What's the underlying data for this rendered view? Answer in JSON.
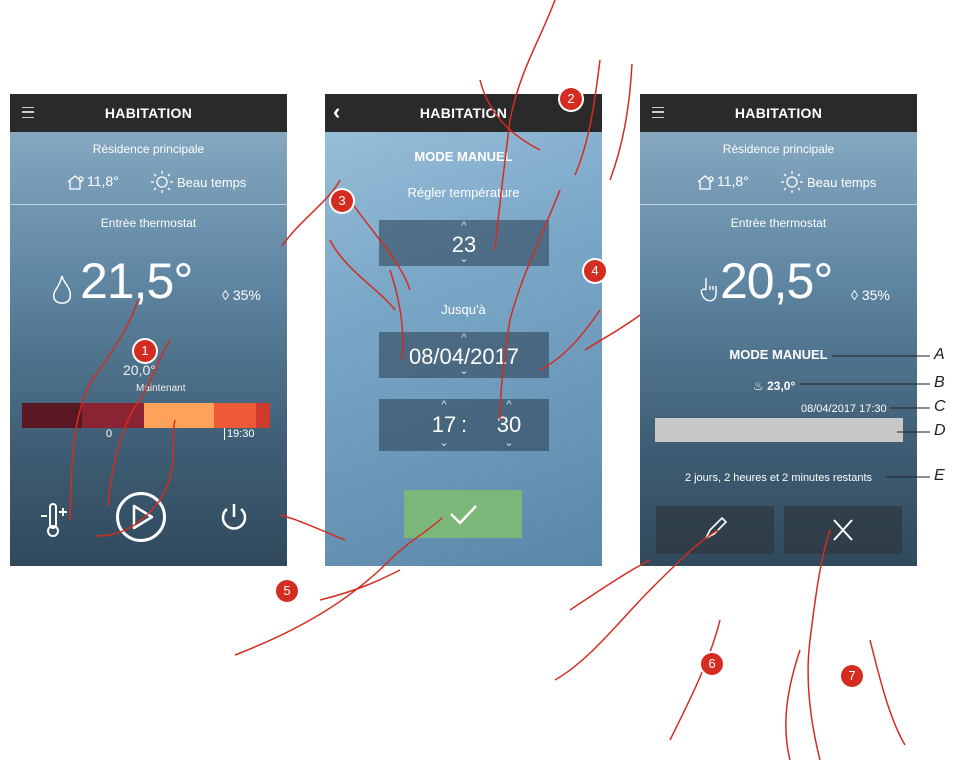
{
  "screens": [
    {
      "title": "HABITATION",
      "residence": "Rèsidence principale",
      "outdoor_temp": "11,8°",
      "weather": "Beau temps",
      "zone": "Entrèe thermostat",
      "current_temp": "21,5°",
      "humidity": "35%",
      "setpoint": "20,0°",
      "now_label": "Maintenant",
      "tick_left": "0",
      "tick_right": "19:30"
    },
    {
      "title": "HABITATION",
      "mode_title": "MODE MANUEL",
      "set_temp_label": "Régler température",
      "temp_value": "23",
      "until_label": "Jusqu'à",
      "date_value": "08/04/2017",
      "hour_value": "17",
      "time_sep": ":",
      "minute_value": "30"
    },
    {
      "title": "HABITATION",
      "residence": "Rèsidence principale",
      "outdoor_temp": "11,8°",
      "weather": "Beau temps",
      "zone": "Entrèe thermostat",
      "current_temp": "20,5°",
      "humidity": "35%",
      "mode": "MODE MANUEL",
      "set_temp": "23,0°",
      "end_datetime": "08/04/2017 17:30",
      "remaining": "2 jours, 2 heures et 2 minutes restants"
    }
  ],
  "callouts": [
    "1",
    "2",
    "3",
    "4",
    "5",
    "6",
    "7"
  ],
  "annotations": [
    "A",
    "B",
    "C",
    "D",
    "E"
  ],
  "colors": {
    "accent_red": "#d42c20",
    "topbar": "#2a2a2a",
    "confirm_green": "#7cb77a",
    "timeline": [
      "#5a1822",
      "#8a2433",
      "#ffa25a",
      "#ef5a36",
      "#cd3a2e"
    ]
  }
}
